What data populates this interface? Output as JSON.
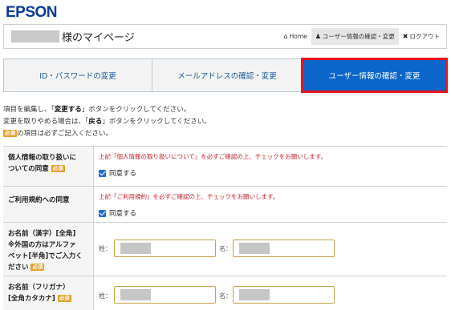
{
  "logo": "EPSON",
  "header": {
    "title": "様のマイページ",
    "nav": [
      {
        "icon": "home-icon",
        "label": "Home"
      },
      {
        "icon": "user-icon",
        "label": "ユーザー情報の確認・変更"
      },
      {
        "icon": "close-icon",
        "label": "ログアウト"
      }
    ]
  },
  "tabs": [
    {
      "label": "ID・パスワードの変更"
    },
    {
      "label": "メールアドレスの確認・変更"
    },
    {
      "label": "ユーザー情報の確認・変更"
    }
  ],
  "instructions": {
    "line1_a": "項目を編集し、「",
    "line1_b": "変更する",
    "line1_c": "」ボタンをクリックしてください。",
    "line2_a": "変更を取りやめる場合は、「",
    "line2_b": "戻る",
    "line2_c": "」ボタンをクリックしてください。",
    "badge": "必須",
    "line3": "の項目は必ずご記入ください。"
  },
  "form": {
    "required_badge": "必須",
    "privacy": {
      "label_1": "個人情報の取り扱いに",
      "label_2": "ついての同意",
      "notice": "上記「個人情報の取り扱いについて」を必ずご確認の上、チェックをお願いします。",
      "checkbox_label": "同意する"
    },
    "terms": {
      "label": "ご利用規約への同意",
      "notice": "上記「ご利用規約」を必ずご確認の上、チェックをお願いします。",
      "checkbox_label": "同意する"
    },
    "name_kanji": {
      "label_1": "お名前（漢字）[全角]",
      "label_2": "※外国の方はアルファ",
      "label_3": "ベット[半角]でご入力く",
      "label_4": "ださい",
      "sei": "姓：",
      "mei": "名："
    },
    "name_kana": {
      "label_1": "お名前（フリガナ）",
      "label_2": "[全角カタカナ]",
      "sei": "姓：",
      "mei": "名："
    }
  }
}
